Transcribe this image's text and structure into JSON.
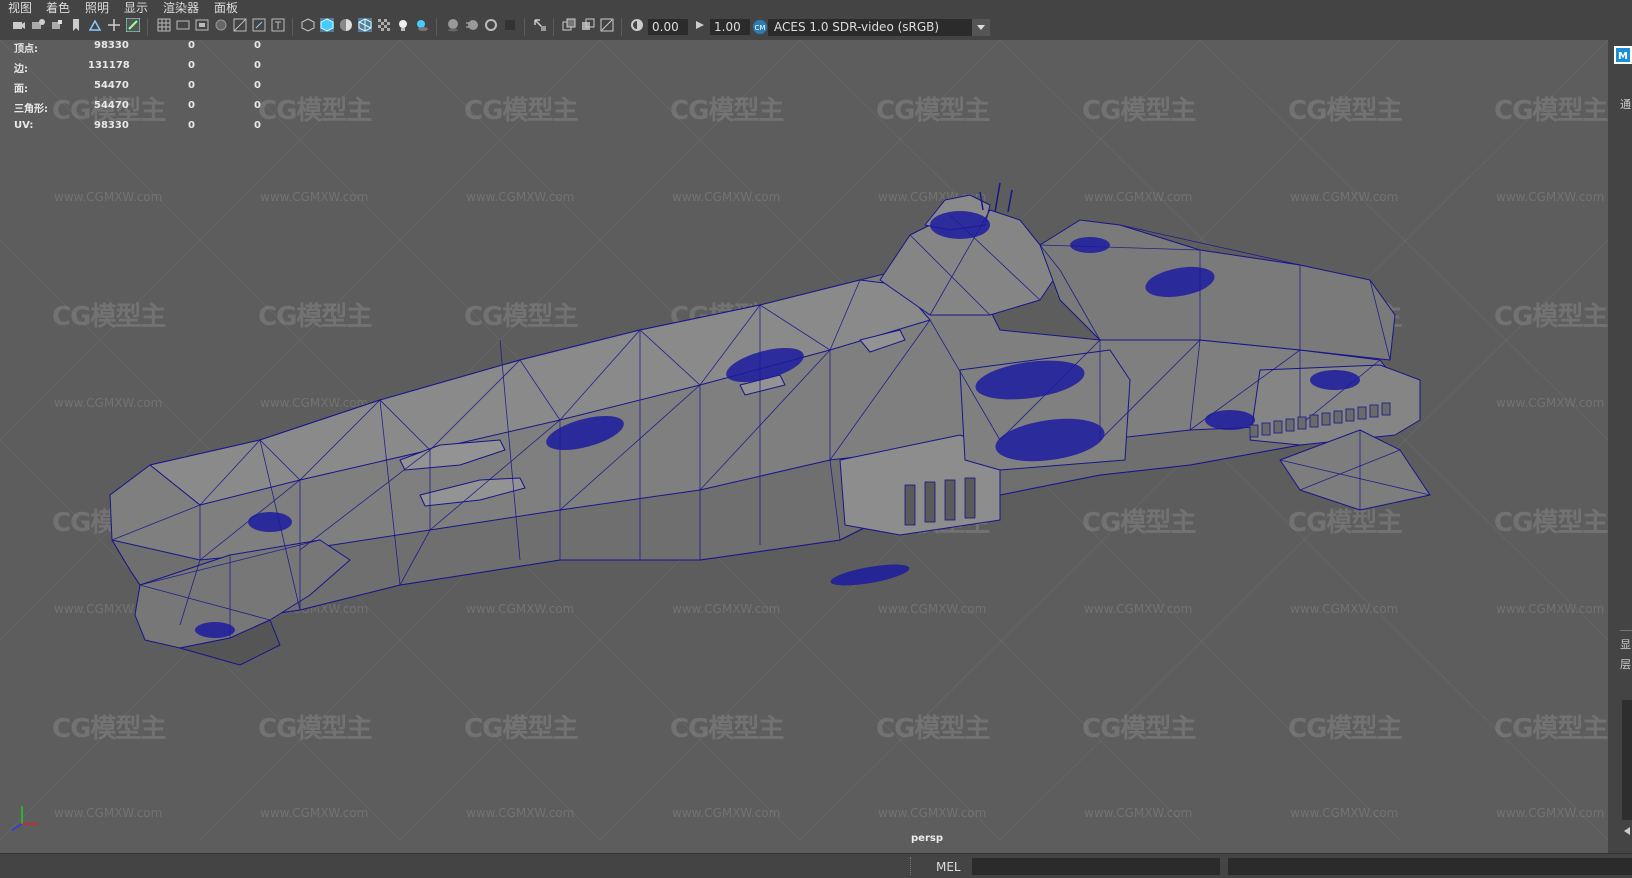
{
  "menubar": {
    "items": [
      "视图",
      "着色",
      "照明",
      "显示",
      "渲染器",
      "面板"
    ]
  },
  "toolbar": {
    "exposure_value": "0.00",
    "gamma_value": "1.00",
    "color_space": "ACES 1.0 SDR-video (sRGB)"
  },
  "hud": {
    "rows": [
      {
        "label": "顶点:",
        "total": "98330",
        "selected": "0",
        "component": "0"
      },
      {
        "label": "边:",
        "total": "131178",
        "selected": "0",
        "component": "0"
      },
      {
        "label": "面:",
        "total": "54470",
        "selected": "0",
        "component": "0"
      },
      {
        "label": "三角形:",
        "total": "54470",
        "selected": "0",
        "component": "0"
      },
      {
        "label": "UV:",
        "total": "98330",
        "selected": "0",
        "component": "0"
      }
    ]
  },
  "viewport": {
    "camera_label": "persp",
    "watermark_logo": "CG模型主",
    "watermark_url": "www.CGMXW.com",
    "background_color": "#5d5d5d",
    "wire_color": "#16168a",
    "model_color": "#7e7e7e"
  },
  "rightstrip": {
    "glyphs": [
      "通",
      "显",
      "层"
    ]
  },
  "statusbar": {
    "mel_label": "MEL"
  },
  "icons": [
    "select-icon",
    "lasso-icon",
    "paint-icon",
    "grid-icon",
    "wireframe-icon",
    "shaded-icon",
    "light-icon",
    "exposure-icon",
    "gamma-icon",
    "color-management-icon",
    "axis-gizmo-icon",
    "maya-logo-icon"
  ]
}
